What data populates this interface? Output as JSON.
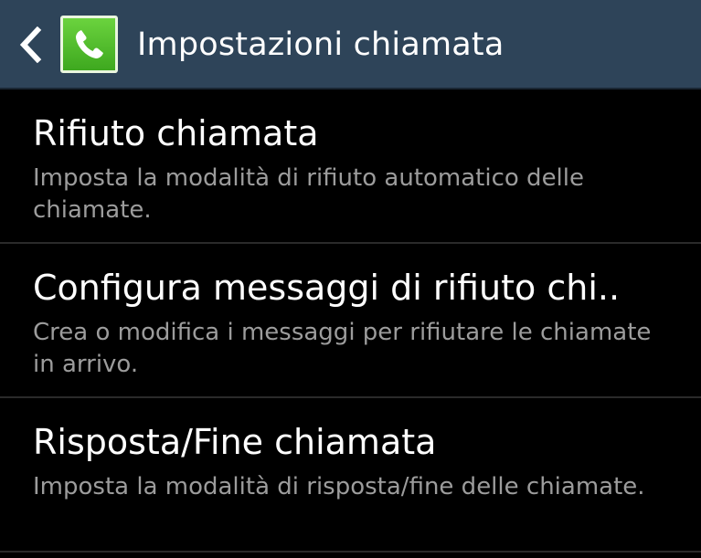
{
  "header": {
    "title": "Impostazioni chiamata",
    "back_icon": "chevron-left-icon",
    "app_icon": "phone-icon",
    "bar_color": "#2e4459",
    "app_icon_color": "#4bb82a"
  },
  "settings": {
    "items": [
      {
        "title": "Rifiuto chiamata",
        "summary": "Imposta la modalità di rifiuto automatico delle chiamate."
      },
      {
        "title": "Configura messaggi di rifiuto chi..",
        "summary": "Crea o modifica i messaggi per rifiutare le chiamate in arrivo."
      },
      {
        "title": "Risposta/Fine chiamata",
        "summary": "Imposta la modalità di risposta/fine delle chiamate."
      }
    ],
    "primary_text_color": "#ffffff",
    "secondary_text_color": "#9c9c9c"
  }
}
